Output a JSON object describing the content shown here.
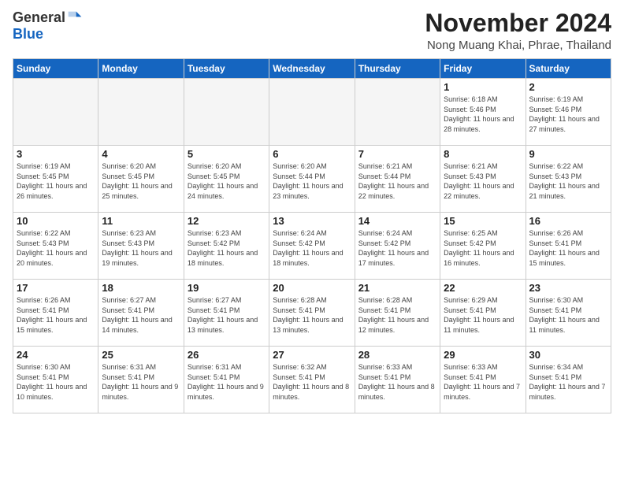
{
  "logo": {
    "general": "General",
    "blue": "Blue"
  },
  "title": {
    "month": "November 2024",
    "location": "Nong Muang Khai, Phrae, Thailand"
  },
  "days_of_week": [
    "Sunday",
    "Monday",
    "Tuesday",
    "Wednesday",
    "Thursday",
    "Friday",
    "Saturday"
  ],
  "weeks": [
    [
      {
        "day": "",
        "info": ""
      },
      {
        "day": "",
        "info": ""
      },
      {
        "day": "",
        "info": ""
      },
      {
        "day": "",
        "info": ""
      },
      {
        "day": "",
        "info": ""
      },
      {
        "day": "1",
        "info": "Sunrise: 6:18 AM\nSunset: 5:46 PM\nDaylight: 11 hours and 28 minutes."
      },
      {
        "day": "2",
        "info": "Sunrise: 6:19 AM\nSunset: 5:46 PM\nDaylight: 11 hours and 27 minutes."
      }
    ],
    [
      {
        "day": "3",
        "info": "Sunrise: 6:19 AM\nSunset: 5:45 PM\nDaylight: 11 hours and 26 minutes."
      },
      {
        "day": "4",
        "info": "Sunrise: 6:20 AM\nSunset: 5:45 PM\nDaylight: 11 hours and 25 minutes."
      },
      {
        "day": "5",
        "info": "Sunrise: 6:20 AM\nSunset: 5:45 PM\nDaylight: 11 hours and 24 minutes."
      },
      {
        "day": "6",
        "info": "Sunrise: 6:20 AM\nSunset: 5:44 PM\nDaylight: 11 hours and 23 minutes."
      },
      {
        "day": "7",
        "info": "Sunrise: 6:21 AM\nSunset: 5:44 PM\nDaylight: 11 hours and 22 minutes."
      },
      {
        "day": "8",
        "info": "Sunrise: 6:21 AM\nSunset: 5:43 PM\nDaylight: 11 hours and 22 minutes."
      },
      {
        "day": "9",
        "info": "Sunrise: 6:22 AM\nSunset: 5:43 PM\nDaylight: 11 hours and 21 minutes."
      }
    ],
    [
      {
        "day": "10",
        "info": "Sunrise: 6:22 AM\nSunset: 5:43 PM\nDaylight: 11 hours and 20 minutes."
      },
      {
        "day": "11",
        "info": "Sunrise: 6:23 AM\nSunset: 5:43 PM\nDaylight: 11 hours and 19 minutes."
      },
      {
        "day": "12",
        "info": "Sunrise: 6:23 AM\nSunset: 5:42 PM\nDaylight: 11 hours and 18 minutes."
      },
      {
        "day": "13",
        "info": "Sunrise: 6:24 AM\nSunset: 5:42 PM\nDaylight: 11 hours and 18 minutes."
      },
      {
        "day": "14",
        "info": "Sunrise: 6:24 AM\nSunset: 5:42 PM\nDaylight: 11 hours and 17 minutes."
      },
      {
        "day": "15",
        "info": "Sunrise: 6:25 AM\nSunset: 5:42 PM\nDaylight: 11 hours and 16 minutes."
      },
      {
        "day": "16",
        "info": "Sunrise: 6:26 AM\nSunset: 5:41 PM\nDaylight: 11 hours and 15 minutes."
      }
    ],
    [
      {
        "day": "17",
        "info": "Sunrise: 6:26 AM\nSunset: 5:41 PM\nDaylight: 11 hours and 15 minutes."
      },
      {
        "day": "18",
        "info": "Sunrise: 6:27 AM\nSunset: 5:41 PM\nDaylight: 11 hours and 14 minutes."
      },
      {
        "day": "19",
        "info": "Sunrise: 6:27 AM\nSunset: 5:41 PM\nDaylight: 11 hours and 13 minutes."
      },
      {
        "day": "20",
        "info": "Sunrise: 6:28 AM\nSunset: 5:41 PM\nDaylight: 11 hours and 13 minutes."
      },
      {
        "day": "21",
        "info": "Sunrise: 6:28 AM\nSunset: 5:41 PM\nDaylight: 11 hours and 12 minutes."
      },
      {
        "day": "22",
        "info": "Sunrise: 6:29 AM\nSunset: 5:41 PM\nDaylight: 11 hours and 11 minutes."
      },
      {
        "day": "23",
        "info": "Sunrise: 6:30 AM\nSunset: 5:41 PM\nDaylight: 11 hours and 11 minutes."
      }
    ],
    [
      {
        "day": "24",
        "info": "Sunrise: 6:30 AM\nSunset: 5:41 PM\nDaylight: 11 hours and 10 minutes."
      },
      {
        "day": "25",
        "info": "Sunrise: 6:31 AM\nSunset: 5:41 PM\nDaylight: 11 hours and 9 minutes."
      },
      {
        "day": "26",
        "info": "Sunrise: 6:31 AM\nSunset: 5:41 PM\nDaylight: 11 hours and 9 minutes."
      },
      {
        "day": "27",
        "info": "Sunrise: 6:32 AM\nSunset: 5:41 PM\nDaylight: 11 hours and 8 minutes."
      },
      {
        "day": "28",
        "info": "Sunrise: 6:33 AM\nSunset: 5:41 PM\nDaylight: 11 hours and 8 minutes."
      },
      {
        "day": "29",
        "info": "Sunrise: 6:33 AM\nSunset: 5:41 PM\nDaylight: 11 hours and 7 minutes."
      },
      {
        "day": "30",
        "info": "Sunrise: 6:34 AM\nSunset: 5:41 PM\nDaylight: 11 hours and 7 minutes."
      }
    ]
  ]
}
